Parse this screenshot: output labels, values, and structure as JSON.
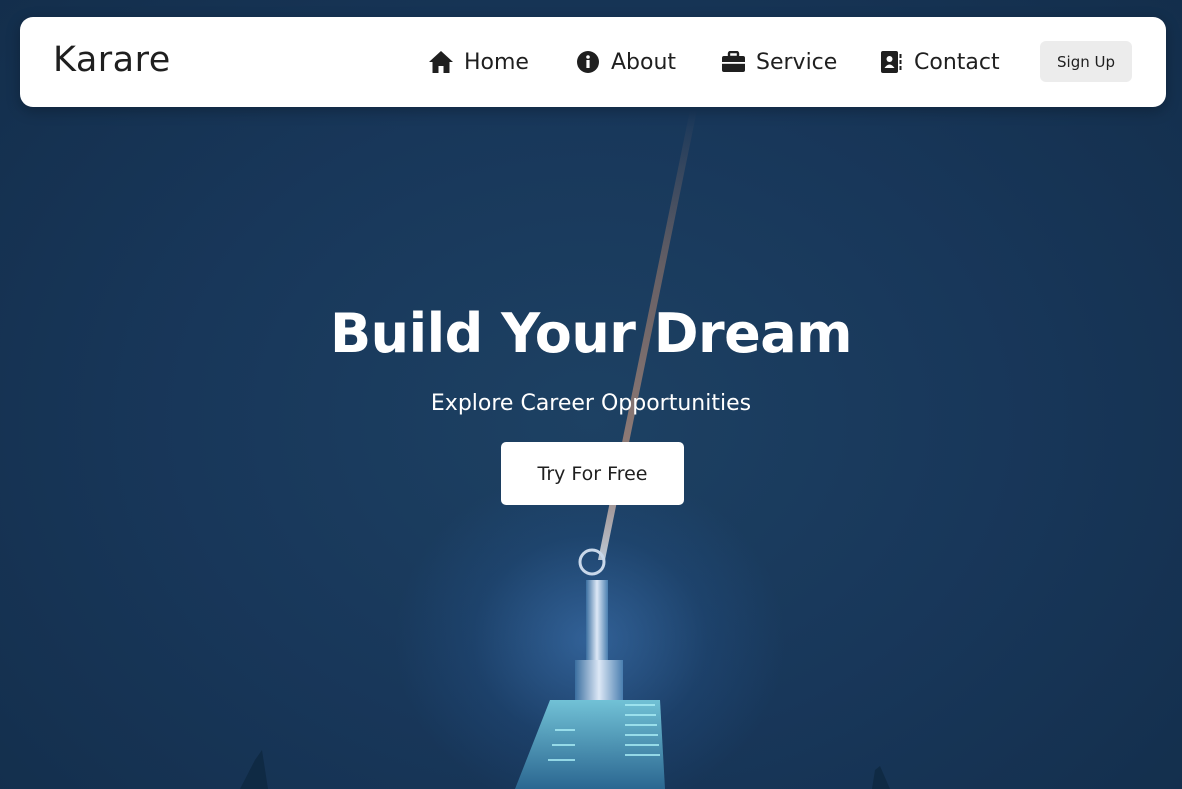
{
  "nav": {
    "brand": "Karare",
    "items": [
      {
        "label": "Home",
        "icon": "home-icon"
      },
      {
        "label": "About",
        "icon": "info-icon"
      },
      {
        "label": "Service",
        "icon": "briefcase-icon"
      },
      {
        "label": "Contact",
        "icon": "address-book-icon"
      }
    ],
    "signup_label": "Sign Up"
  },
  "hero": {
    "title": "Build Your Dream",
    "subtitle": "Explore Career Opportunities",
    "cta_label": "Try For Free"
  },
  "colors": {
    "navbar_bg": "#ffffff",
    "text_dark": "#1f1f1f",
    "hero_bg": "#17304d",
    "signup_bg": "#ececec",
    "cta_bg": "#ffffff"
  }
}
